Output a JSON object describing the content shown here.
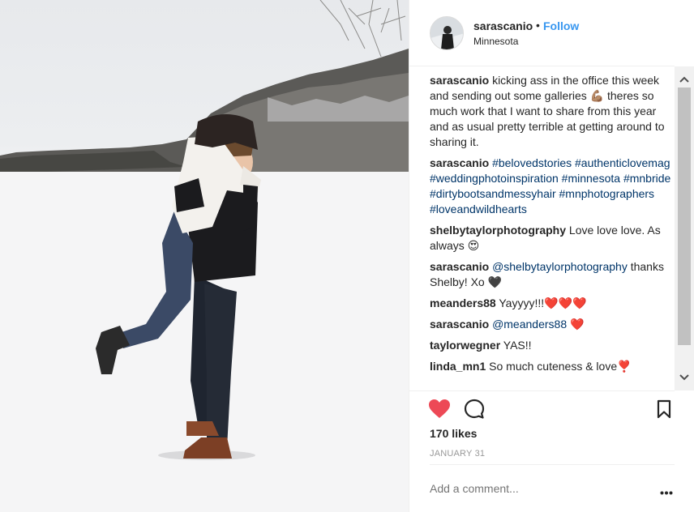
{
  "post": {
    "username": "sarascanio",
    "separator": "•",
    "follow_label": "Follow",
    "location": "Minnesota",
    "likes": "170 likes",
    "date": "JANUARY 31",
    "add_comment_placeholder": "Add a comment...",
    "liked": true
  },
  "comments": [
    {
      "user": "sarascanio",
      "text": "kicking ass in the office this week and sending out some galleries 💪🏽 theres so much work that I want to share from this year and as usual pretty terrible at getting around to sharing it."
    },
    {
      "user": "sarascanio",
      "hashtags": "#belovedstories #authenticlovemag #weddingphotoinspiration #minnesota #mnbride #dirtybootsandmessyhair #mnphotographers #loveandwildhearts"
    },
    {
      "user": "shelbytaylorphotography",
      "text": "Love love love. As always 😍"
    },
    {
      "user": "sarascanio",
      "mention": "@shelbytaylorphotography",
      "text": "thanks Shelby! Xo 🖤"
    },
    {
      "user": "meanders88",
      "text": "Yayyyy!!!❤️❤️❤️"
    },
    {
      "user": "sarascanio",
      "mention": "@meanders88",
      "text": "❤️"
    },
    {
      "user": "taylorwegner",
      "text": "YAS!!"
    },
    {
      "user": "linda_mn1",
      "text": "So much cuteness & love❣️"
    }
  ],
  "icons": {
    "like": "heart-icon",
    "comment": "comment-bubble-icon",
    "save": "bookmark-icon",
    "more": "more-options-icon",
    "scroll_up": "scroll-up-arrow",
    "scroll_down": "scroll-down-arrow"
  },
  "colors": {
    "accent": "#3897f0",
    "like_red": "#ed4956",
    "hashtag": "#003569"
  }
}
